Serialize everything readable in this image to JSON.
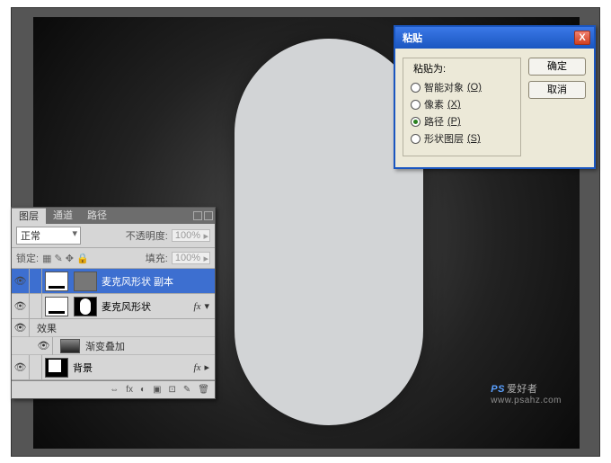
{
  "watermark": {
    "brand": "PS",
    "text": "爱好者",
    "url": "www.psahz.com"
  },
  "dialog": {
    "title": "粘贴",
    "close": "X",
    "legend": "粘贴为:",
    "options": [
      {
        "label": "智能对象",
        "accel": "(O)",
        "selected": false
      },
      {
        "label": "像素",
        "accel": "(X)",
        "selected": false
      },
      {
        "label": "路径",
        "accel": "(P)",
        "selected": true
      },
      {
        "label": "形状图层",
        "accel": "(S)",
        "selected": false
      }
    ],
    "ok": "确定",
    "cancel": "取消"
  },
  "panel": {
    "tabs": [
      "图层",
      "通道",
      "路径"
    ],
    "blend_label": "正常",
    "opacity_label": "不透明度:",
    "opacity_value": "100%",
    "lock_label": "锁定:",
    "fill_label": "填充:",
    "fill_value": "100%",
    "layers": [
      {
        "name": "麦克风形状 副本",
        "selected": true,
        "mask": true,
        "thumb": "dark"
      },
      {
        "name": "麦克风形状",
        "selected": false,
        "mask": true,
        "thumb": "white",
        "fx": true
      }
    ],
    "fx_label": "效果",
    "fx_item": "渐变叠加",
    "bg_name": "背景",
    "foot_icons": [
      "⇔",
      "fx",
      "◐",
      "▣",
      "⊡",
      "✎",
      "🗑"
    ]
  }
}
